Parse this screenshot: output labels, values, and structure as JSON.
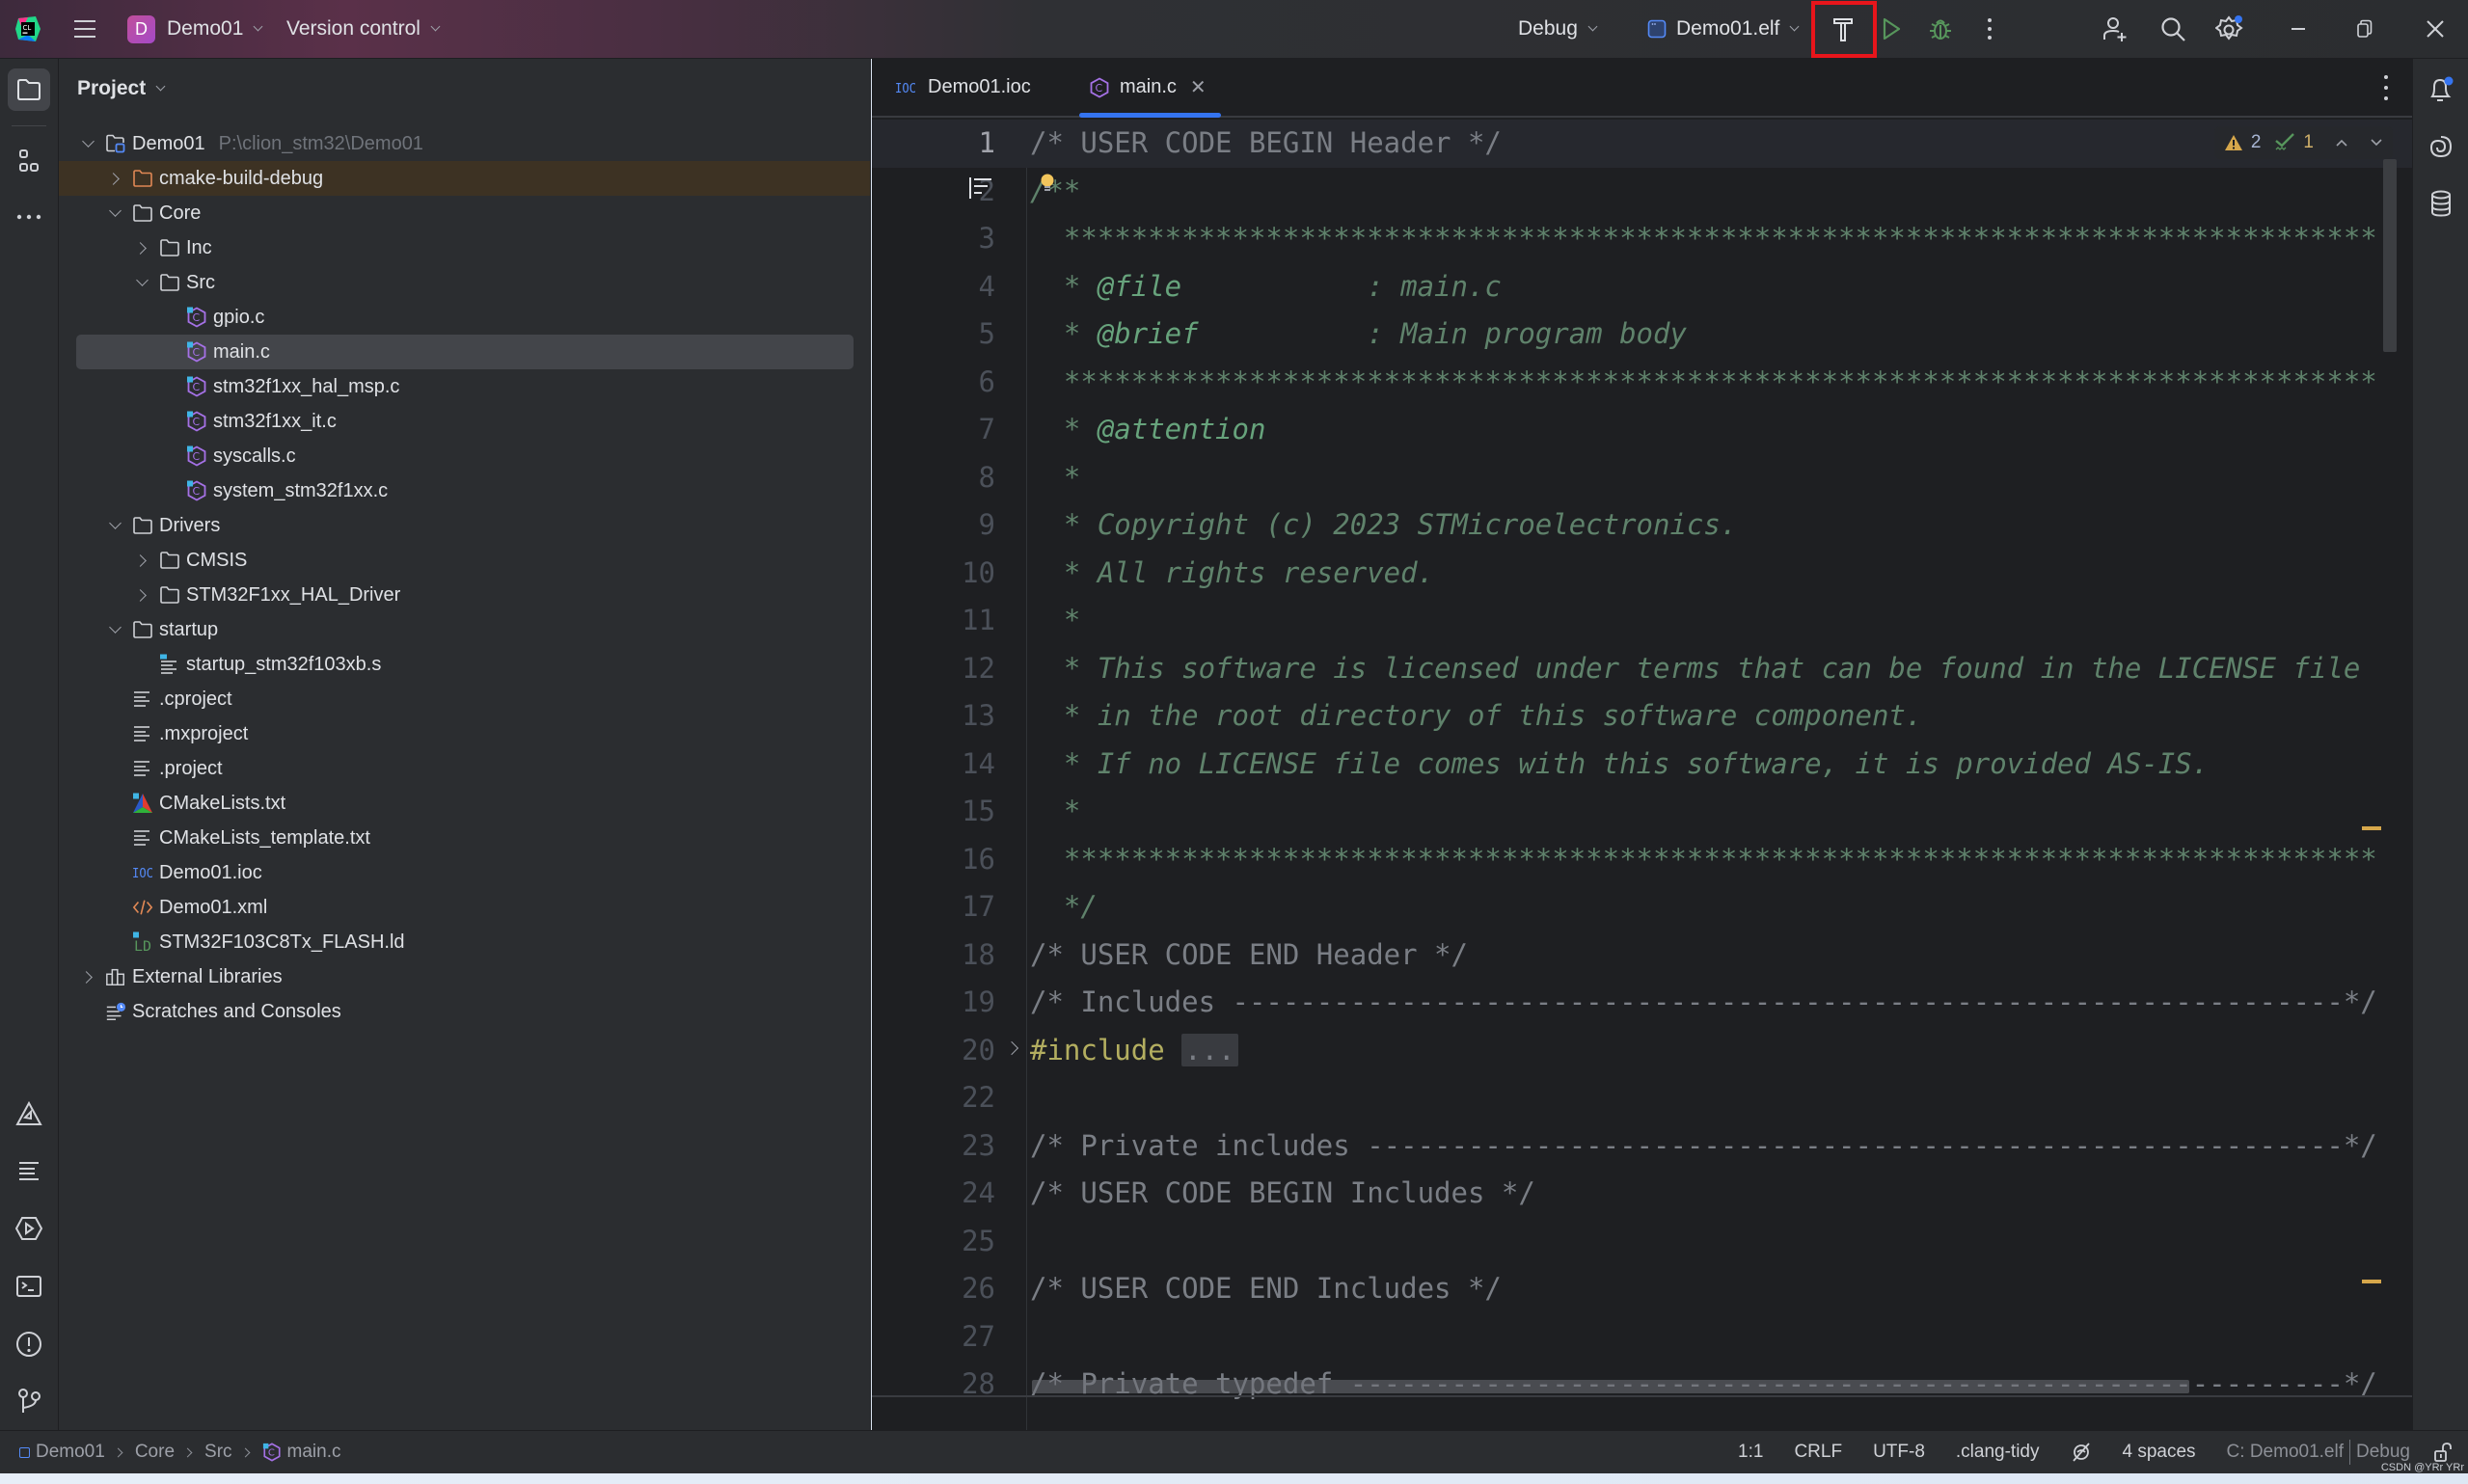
{
  "titlebar": {
    "project_badge": "D",
    "project_name": "Demo01",
    "vcs_label": "Version control",
    "config_profile": "Debug",
    "run_target": "Demo01.elf",
    "build_button_highlight_color": "#e8151b"
  },
  "project_panel": {
    "title": "Project",
    "tree": [
      {
        "label": "Demo01",
        "hint": "P:\\clion_stm32\\Demo01",
        "depth": 0,
        "toggle": "open",
        "icon": "project-folder-icon"
      },
      {
        "label": "cmake-build-debug",
        "depth": 1,
        "toggle": "closed",
        "icon": "excluded-folder-icon",
        "excluded": true
      },
      {
        "label": "Core",
        "depth": 1,
        "toggle": "open",
        "icon": "folder-icon"
      },
      {
        "label": "Inc",
        "depth": 2,
        "toggle": "closed",
        "icon": "folder-icon"
      },
      {
        "label": "Src",
        "depth": 2,
        "toggle": "open",
        "icon": "folder-icon"
      },
      {
        "label": "gpio.c",
        "depth": 3,
        "icon": "c-file-icon"
      },
      {
        "label": "main.c",
        "depth": 3,
        "icon": "c-file-icon",
        "selected": true
      },
      {
        "label": "stm32f1xx_hal_msp.c",
        "depth": 3,
        "icon": "c-file-icon"
      },
      {
        "label": "stm32f1xx_it.c",
        "depth": 3,
        "icon": "c-file-icon"
      },
      {
        "label": "syscalls.c",
        "depth": 3,
        "icon": "c-file-icon"
      },
      {
        "label": "system_stm32f1xx.c",
        "depth": 3,
        "icon": "c-file-icon"
      },
      {
        "label": "Drivers",
        "depth": 1,
        "toggle": "open",
        "icon": "folder-icon"
      },
      {
        "label": "CMSIS",
        "depth": 2,
        "toggle": "closed",
        "icon": "folder-icon"
      },
      {
        "label": "STM32F1xx_HAL_Driver",
        "depth": 2,
        "toggle": "closed",
        "icon": "folder-icon"
      },
      {
        "label": "startup",
        "depth": 1,
        "toggle": "open",
        "icon": "folder-icon"
      },
      {
        "label": "startup_stm32f103xb.s",
        "depth": 2,
        "icon": "asm-file-icon"
      },
      {
        "label": ".cproject",
        "depth": 1,
        "icon": "text-file-icon"
      },
      {
        "label": ".mxproject",
        "depth": 1,
        "icon": "text-file-icon"
      },
      {
        "label": ".project",
        "depth": 1,
        "icon": "text-file-icon"
      },
      {
        "label": "CMakeLists.txt",
        "depth": 1,
        "icon": "cmake-icon"
      },
      {
        "label": "CMakeLists_template.txt",
        "depth": 1,
        "icon": "text-file-icon"
      },
      {
        "label": "Demo01.ioc",
        "depth": 1,
        "icon": "ioc-file-icon"
      },
      {
        "label": "Demo01.xml",
        "depth": 1,
        "icon": "xml-file-icon"
      },
      {
        "label": "STM32F103C8Tx_FLASH.ld",
        "depth": 1,
        "icon": "ld-file-icon"
      },
      {
        "label": "External Libraries",
        "depth": 0,
        "toggle": "closed",
        "icon": "library-icon"
      },
      {
        "label": "Scratches and Consoles",
        "depth": 0,
        "icon": "scratches-icon"
      }
    ]
  },
  "editor": {
    "tabs": [
      {
        "label": "Demo01.ioc",
        "icon": "ioc-file-icon",
        "active": false
      },
      {
        "label": "main.c",
        "icon": "c-file-icon",
        "active": true,
        "closable": true
      }
    ],
    "inspections": {
      "warnings": "2",
      "weak_warnings": "1"
    },
    "lines": [
      {
        "n": "1",
        "text": "/* USER CODE BEGIN Header */",
        "style": "comment",
        "current": true
      },
      {
        "n": "2",
        "text": "/**",
        "style": "doc"
      },
      {
        "n": "3",
        "text": "  ******************************************************************************",
        "style": "doc"
      },
      {
        "n": "4",
        "pre": "  * ",
        "tag": "@file",
        "text": "           : main.c",
        "style": "doc"
      },
      {
        "n": "5",
        "pre": "  * ",
        "tag": "@brief",
        "text": "          : Main program body",
        "style": "doc"
      },
      {
        "n": "6",
        "text": "  ******************************************************************************",
        "style": "doc"
      },
      {
        "n": "7",
        "pre": "  * ",
        "tag": "@attention",
        "text": "",
        "style": "doc"
      },
      {
        "n": "8",
        "text": "  *",
        "style": "doc"
      },
      {
        "n": "9",
        "text": "  * Copyright (c) 2023 STMicroelectronics.",
        "style": "doc"
      },
      {
        "n": "10",
        "text": "  * All rights reserved.",
        "style": "doc"
      },
      {
        "n": "11",
        "text": "  *",
        "style": "doc"
      },
      {
        "n": "12",
        "text": "  * This software is licensed under terms that can be found in the LICENSE file",
        "style": "doc"
      },
      {
        "n": "13",
        "text": "  * in the root directory of this software component.",
        "style": "doc"
      },
      {
        "n": "14",
        "text": "  * If no LICENSE file comes with this software, it is provided AS-IS.",
        "style": "doc"
      },
      {
        "n": "15",
        "text": "  *",
        "style": "doc"
      },
      {
        "n": "16",
        "text": "  ******************************************************************************",
        "style": "doc"
      },
      {
        "n": "17",
        "text": "  */",
        "style": "doc"
      },
      {
        "n": "18",
        "text": "/* USER CODE END Header */",
        "style": "comment"
      },
      {
        "n": "19",
        "text": "/* Includes ------------------------------------------------------------------*/",
        "style": "comment"
      },
      {
        "n": "20",
        "text": "#include ",
        "fold": "...",
        "style": "pre",
        "folded": true
      },
      {
        "n": "22",
        "text": "",
        "style": "comment"
      },
      {
        "n": "23",
        "text": "/* Private includes ----------------------------------------------------------*/",
        "style": "comment"
      },
      {
        "n": "24",
        "text": "/* USER CODE BEGIN Includes */",
        "style": "comment"
      },
      {
        "n": "25",
        "text": "",
        "style": "comment"
      },
      {
        "n": "26",
        "text": "/* USER CODE END Includes */",
        "style": "comment"
      },
      {
        "n": "27",
        "text": "",
        "style": "comment"
      },
      {
        "n": "28",
        "text": "/* Private typedef -----------------------------------------------------------*/",
        "style": "comment"
      }
    ]
  },
  "statusbar": {
    "breadcrumbs": [
      "Demo01",
      "Core",
      "Src",
      "main.c"
    ],
    "position": "1:1",
    "line_separator": "CRLF",
    "encoding": "UTF-8",
    "code_style": ".clang-tidy",
    "indent": "4 spaces",
    "context": "C: Demo01.elf",
    "context_profile": "Debug"
  },
  "watermark": "CSDN @YRr YRr"
}
